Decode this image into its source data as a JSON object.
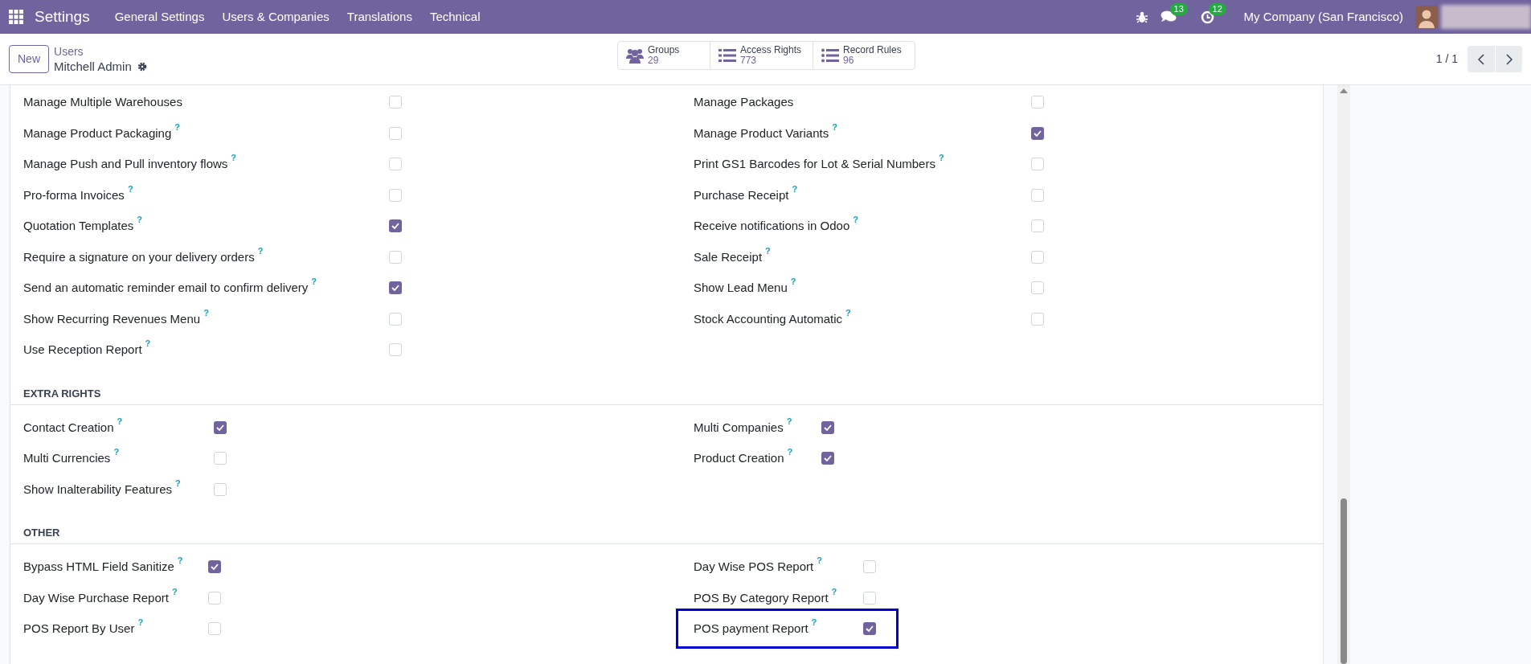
{
  "navbar": {
    "app": "Settings",
    "menu": [
      "General Settings",
      "Users & Companies",
      "Translations",
      "Technical"
    ],
    "messages_count": "13",
    "activities_count": "12",
    "company": "My Company (San Francisco)"
  },
  "control_panel": {
    "new_button": "New",
    "breadcrumb": "Users",
    "record": "Mitchell Admin",
    "smart_buttons": [
      {
        "label": "Groups",
        "count": "29"
      },
      {
        "label": "Access Rights",
        "count": "773"
      },
      {
        "label": "Record Rules",
        "count": "96"
      }
    ],
    "pager": "1 / 1"
  },
  "sections": [
    {
      "left": [
        {
          "label": "Manage Multiple Warehouses",
          "checked": false,
          "highlighted": false
        },
        {
          "label": "Manage Product Packaging",
          "help": "?",
          "checked": false,
          "highlighted": false
        },
        {
          "label": "Manage Push and Pull inventory flows",
          "help": "?",
          "checked": false,
          "highlighted": false
        },
        {
          "label": "Pro-forma Invoices",
          "help": "?",
          "checked": false,
          "highlighted": false
        },
        {
          "label": "Quotation Templates",
          "help": "?",
          "checked": true,
          "highlighted": false
        },
        {
          "label": "Require a signature on your delivery orders",
          "help": "?",
          "checked": false,
          "highlighted": false
        },
        {
          "label": "Send an automatic reminder email to confirm delivery",
          "help": "?",
          "checked": true,
          "highlighted": false
        },
        {
          "label": "Show Recurring Revenues Menu",
          "help": "?",
          "checked": false,
          "highlighted": false
        },
        {
          "label": "Use Reception Report",
          "help": "?",
          "checked": false,
          "highlighted": false
        }
      ],
      "right": [
        {
          "label": "Manage Packages",
          "checked": false,
          "highlighted": false
        },
        {
          "label": "Manage Product Variants",
          "help": "?",
          "checked": true,
          "highlighted": false
        },
        {
          "label": "Print GS1 Barcodes for Lot & Serial Numbers",
          "help": "?",
          "checked": false,
          "highlighted": false
        },
        {
          "label": "Purchase Receipt",
          "help": "?",
          "checked": false,
          "highlighted": false
        },
        {
          "label": "Receive notifications in Odoo",
          "help": "?",
          "checked": false,
          "highlighted": false
        },
        {
          "label": "Sale Receipt",
          "help": "?",
          "checked": false,
          "highlighted": false
        },
        {
          "label": "Show Lead Menu",
          "help": "?",
          "checked": false,
          "highlighted": false
        },
        {
          "label": "Stock Accounting Automatic",
          "help": "?",
          "checked": false,
          "highlighted": false
        }
      ]
    },
    {
      "title": "EXTRA RIGHTS",
      "left": [
        {
          "label": "Contact Creation",
          "help": "?",
          "checked": true,
          "highlighted": false
        },
        {
          "label": "Multi Currencies",
          "help": "?",
          "checked": false,
          "highlighted": false
        },
        {
          "label": "Show Inalterability Features",
          "help": "?",
          "checked": false,
          "highlighted": false
        }
      ],
      "right": [
        {
          "label": "Multi Companies",
          "help": "?",
          "checked": true,
          "highlighted": false
        },
        {
          "label": "Product Creation",
          "help": "?",
          "checked": true,
          "highlighted": false
        }
      ]
    },
    {
      "title": "OTHER",
      "left": [
        {
          "label": "Bypass HTML Field Sanitize",
          "help": "?",
          "checked": true,
          "highlighted": false
        },
        {
          "label": "Day Wise Purchase Report",
          "help": "?",
          "checked": false,
          "highlighted": false
        },
        {
          "label": "POS Report By User",
          "help": "?",
          "checked": false,
          "highlighted": false
        }
      ],
      "right": [
        {
          "label": "Day Wise POS Report",
          "help": "?",
          "checked": false,
          "highlighted": false
        },
        {
          "label": "POS By Category Report",
          "help": "?",
          "checked": false,
          "highlighted": false
        },
        {
          "label": "POS payment Report",
          "help": "?",
          "checked": true,
          "highlighted": true
        }
      ]
    }
  ]
}
